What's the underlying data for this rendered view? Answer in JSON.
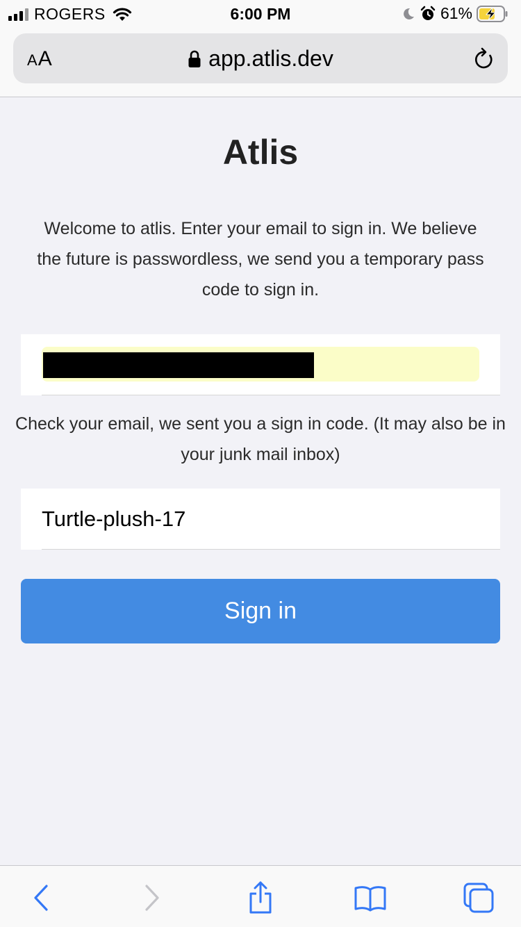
{
  "status_bar": {
    "carrier": "ROGERS",
    "time": "6:00 PM",
    "battery_percent": "61%",
    "icons": [
      "signal-icon",
      "wifi-icon",
      "moon-icon",
      "alarm-icon",
      "battery-charging-icon"
    ]
  },
  "address_bar": {
    "text_size_small": "A",
    "text_size_large": "A",
    "url": "app.atlis.dev",
    "icons": [
      "lock-icon",
      "reload-icon"
    ]
  },
  "page": {
    "title": "Atlis",
    "welcome_text": "Welcome to atlis. Enter your email to sign in. We believe the future is passwordless, we send you a temporary pass code to sign in.",
    "email_value": "",
    "check_email_text": "Check your email, we sent you a sign in code. (It may also be in your junk mail inbox)",
    "code_value": "Turtle-plush-17",
    "sign_in_label": "Sign in"
  },
  "toolbar": {
    "icons": [
      "back-icon",
      "forward-icon",
      "share-icon",
      "bookmarks-icon",
      "tabs-icon"
    ]
  },
  "colors": {
    "accent": "#438be2",
    "background": "#f2f2f7",
    "autofill": "#fbfdc8",
    "toolbar_icon": "#3478f6",
    "toolbar_icon_disabled": "#c4c4c8"
  }
}
